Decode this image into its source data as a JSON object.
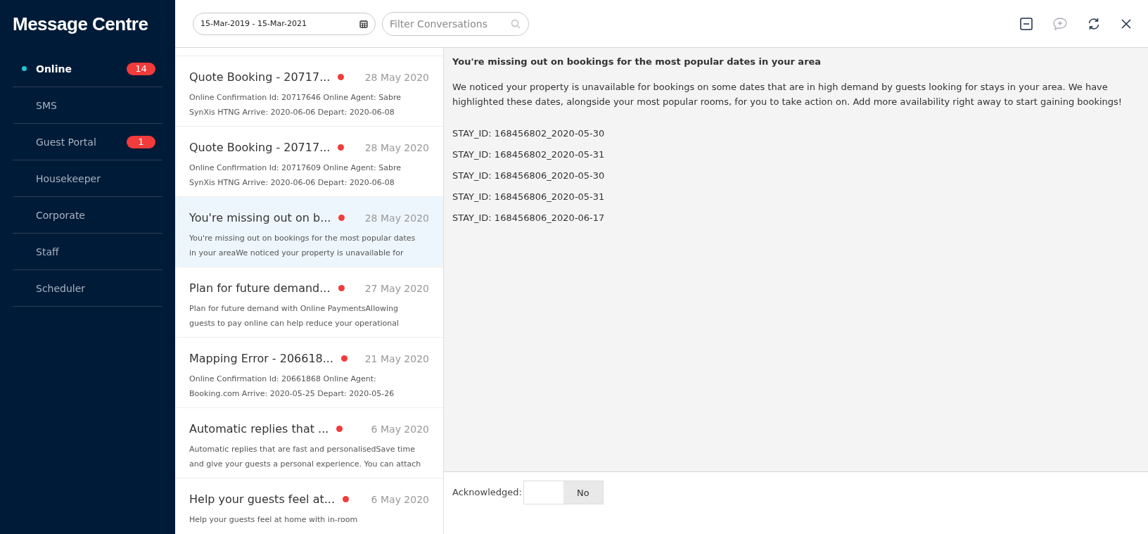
{
  "sidebar": {
    "title": "Message Centre",
    "items": [
      {
        "label": "Online",
        "selected": true,
        "badge": "14"
      },
      {
        "label": "SMS",
        "selected": false
      },
      {
        "label": "Guest Portal",
        "selected": false,
        "badge": "1"
      },
      {
        "label": "Housekeeper",
        "selected": false
      },
      {
        "label": "Corporate",
        "selected": false
      },
      {
        "label": "Staff",
        "selected": false
      },
      {
        "label": "Scheduler",
        "selected": false
      }
    ]
  },
  "toolbar": {
    "date_range": "15-Mar-2019 - 15-Mar-2021",
    "filter": {
      "placeholder": "Filter Conversations"
    }
  },
  "conversations": [
    {
      "title": "Quote Booking - 20717...",
      "date": "28 May 2020",
      "unread": true,
      "selected": false,
      "preview": "Online Confirmation Id: 20717646 Online Agent: Sabre SynXis HTNG Arrive: 2020-06-06 Depart: 2020-06-08"
    },
    {
      "title": "Quote Booking - 20717...",
      "date": "28 May 2020",
      "unread": true,
      "selected": false,
      "preview": "Online Confirmation Id: 20717609 Online Agent: Sabre SynXis HTNG Arrive: 2020-06-06 Depart: 2020-06-08"
    },
    {
      "title": "You're missing out on b...",
      "date": "28 May 2020",
      "unread": true,
      "selected": true,
      "preview": "You're missing out on bookings for the most popular dates in your areaWe noticed your property is unavailable for"
    },
    {
      "title": "Plan for future demand...",
      "date": "27 May 2020",
      "unread": true,
      "selected": false,
      "preview": "Plan for future demand with Online PaymentsAllowing guests to pay online can help reduce your operational"
    },
    {
      "title": "Mapping Error - 206618...",
      "date": "21 May 2020",
      "unread": true,
      "selected": false,
      "preview": "Online Confirmation Id: 20661868 Online Agent: Booking.com Arrive: 2020-05-25 Depart: 2020-05-26"
    },
    {
      "title": "Automatic replies that ...",
      "date": "6 May 2020",
      "unread": true,
      "selected": false,
      "preview": "Automatic replies that are fast and personalisedSave time and give your guests a personal experience. You can attach"
    },
    {
      "title": "Help your guests feel at...",
      "date": "6 May 2020",
      "unread": true,
      "selected": false,
      "preview": "Help your guests feel at home with in-room"
    }
  ],
  "message": {
    "subject": "You're missing out on bookings for the most popular dates in your area",
    "body": "We noticed your property is unavailable for bookings on some dates that are in high demand by guests looking for stays in your area. We have highlighted these dates, alongside your most popular rooms, for you to take action on. Add more availability right away to start gaining bookings!",
    "lines": [
      "STAY_ID: 168456802_2020-05-30",
      "STAY_ID: 168456802_2020-05-31",
      "STAY_ID: 168456806_2020-05-30",
      "STAY_ID: 168456806_2020-05-31",
      "STAY_ID: 168456806_2020-06-17"
    ]
  },
  "acknowledged": {
    "label": "Acknowledged:",
    "value_text": "No",
    "on": false
  }
}
